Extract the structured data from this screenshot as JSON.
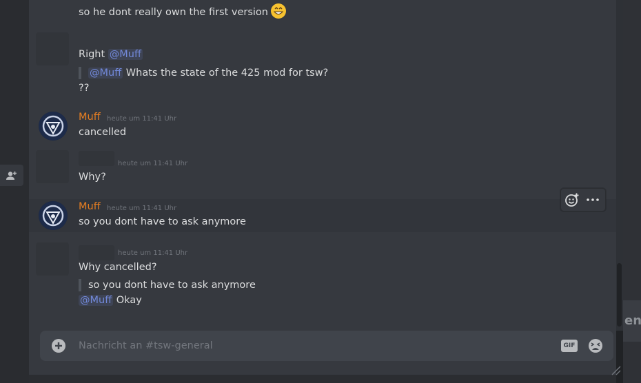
{
  "messages": [
    {
      "text": "so he dont really own the first version"
    },
    {
      "text_before": "Right ",
      "mention": "@Muff",
      "reply_mention": "@Muff",
      "reply_text": " Whats the state of the 425 mod for tsw?",
      "after_text": "??"
    },
    {
      "username": "Muff",
      "timestamp": "heute um 11:41 Uhr",
      "text": "cancelled"
    },
    {
      "timestamp": "heute um 11:41 Uhr",
      "text": "Why?"
    },
    {
      "username": "Muff",
      "timestamp": "heute um 11:41 Uhr",
      "text": "so you dont have to ask anymore"
    },
    {
      "timestamp": "heute um 11:41 Uhr",
      "text": "Why cancelled?",
      "quote": "so you dont have to ask anymore",
      "mention": "@Muff",
      "after_mention": " Okay"
    }
  ],
  "composer": {
    "placeholder": "Nachricht an #tsw-general",
    "gif_label": "GIF"
  },
  "side_peek": {
    "text": "en"
  },
  "colors": {
    "username": "#e67e22",
    "mention": "#7289da",
    "background": "#36393f"
  }
}
